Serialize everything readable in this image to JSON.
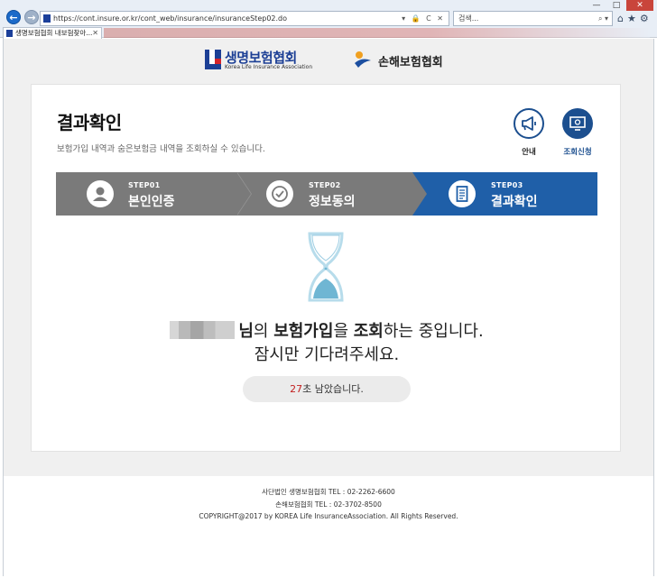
{
  "browser": {
    "url": "https://cont.insure.or.kr/cont_web/insurance/insuranceStep02.do",
    "search_placeholder": "검색...",
    "tab_title": "생명보험협회 내보험찾아..."
  },
  "header": {
    "life_logo_name": "생명보험협회",
    "life_logo_en": "Korea Life Insurance Association",
    "nonlife_logo_name": "손해보험협회"
  },
  "main": {
    "title": "결과확인",
    "subtitle": "보험가입 내역과 숨은보험금 내역을 조회하실 수 있습니다.",
    "guide_label": "안내",
    "inquiry_label": "조회신청"
  },
  "steps": [
    {
      "num": "STEP01",
      "name": "본인인증"
    },
    {
      "num": "STEP02",
      "name": "정보동의"
    },
    {
      "num": "STEP03",
      "name": "결과확인"
    }
  ],
  "message": {
    "suffix_nim": "님",
    "particle_ui": "의 ",
    "insurance_join": "보험가입",
    "particle_eul": "을 ",
    "inquiry": "조회",
    "ending": "하는 중입니다.",
    "line2": "잠시만 기다려주세요."
  },
  "countdown": {
    "seconds": "27",
    "suffix": "초 남았습니다."
  },
  "footer": {
    "line1": "사단법인 생명보험협회 TEL : 02-2262-6600",
    "line2": "손해보험협회 TEL : 02-3702-8500",
    "line3": "COPYRIGHT@2017 by KOREA Life InsuranceAssociation. All Rights Reserved."
  },
  "colors": {
    "accent": "#1f5fa8",
    "step_inactive": "#7a7a7a",
    "countdown_highlight": "#c21f1f"
  }
}
